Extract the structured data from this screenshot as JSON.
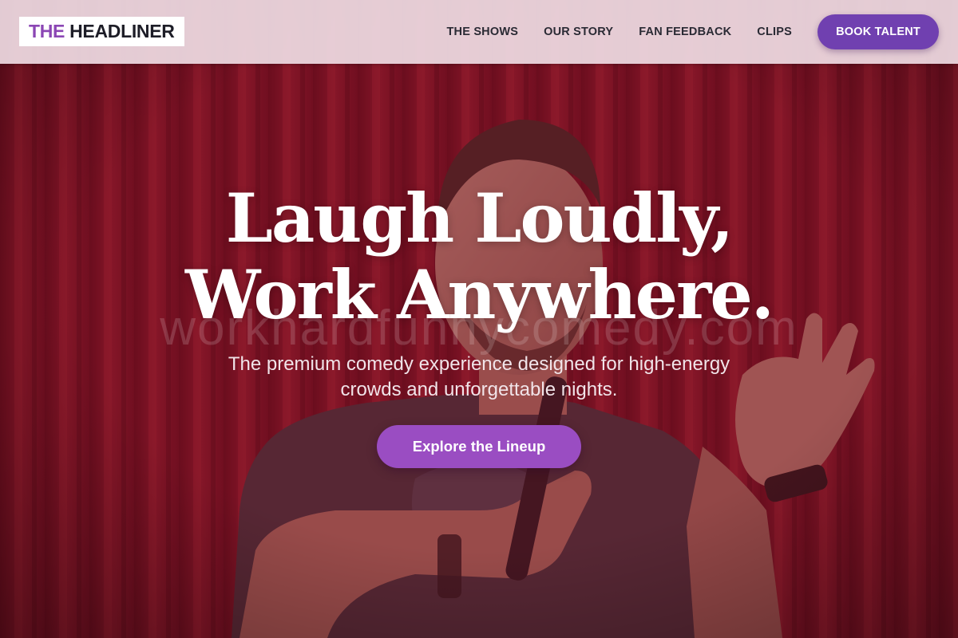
{
  "header": {
    "logo": {
      "accent": "THE",
      "main": "HEADLINER"
    },
    "nav": [
      {
        "label": "THE SHOWS"
      },
      {
        "label": "OUR STORY"
      },
      {
        "label": "FAN FEEDBACK"
      },
      {
        "label": "CLIPS"
      }
    ],
    "cta_label": "BOOK TALENT"
  },
  "hero": {
    "title_line1": "Laugh Loudly,",
    "title_line2": "Work Anywhere.",
    "watermark": "workhardfunnycomedy.com",
    "subtitle": "The premium comedy experience designed for high-energy crowds and unforgettable nights.",
    "cta_label": "Explore the Lineup",
    "background_image": "comedian-on-stage-red-curtain"
  },
  "colors": {
    "brand_purple": "#7040b0",
    "accent_purple": "#9a4dc2",
    "logo_accent": "#8b46b4",
    "curtain_red": "#8e1a2a",
    "header_bg": "#eedae2"
  }
}
